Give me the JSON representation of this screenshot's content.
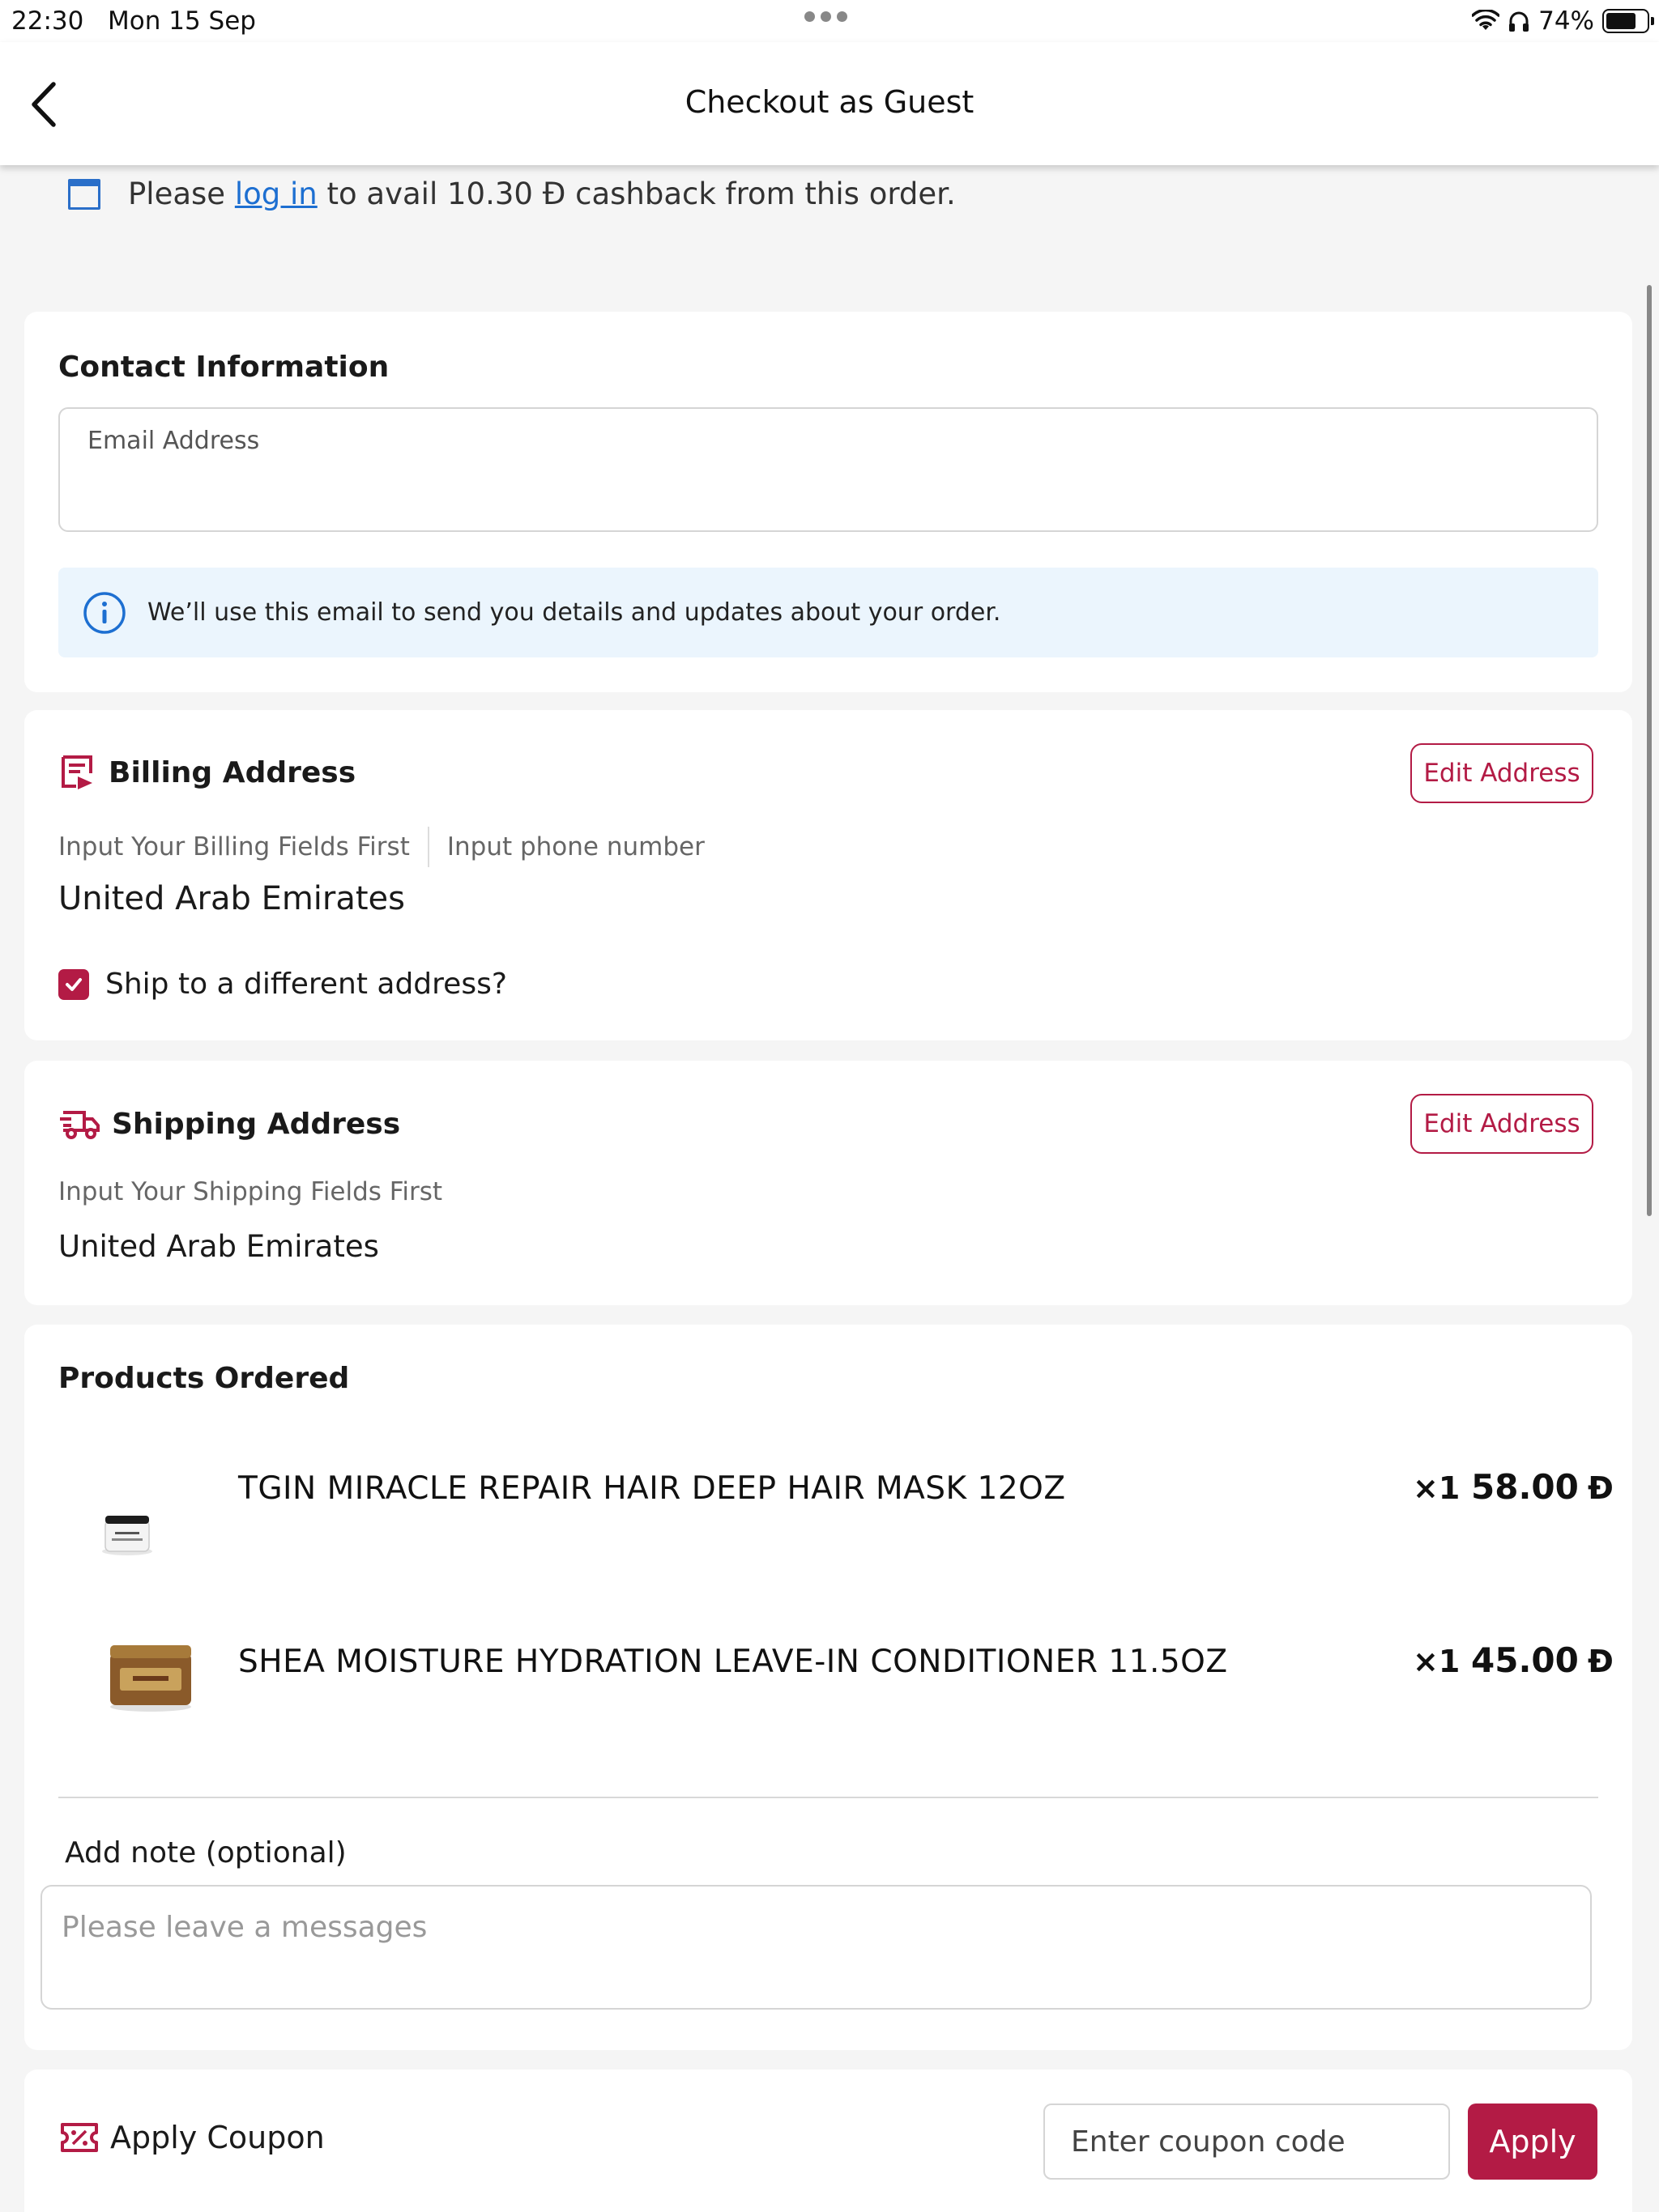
{
  "status": {
    "time": "22:30",
    "date": "Mon 15 Sep",
    "battery_text": "74%",
    "battery_level": 0.74
  },
  "nav": {
    "title": "Checkout as Guest"
  },
  "cashback": {
    "prefix": "Please",
    "link": "log in",
    "middle": "to avail 10.30",
    "currency": "Đ",
    "suffix": "cashback from this order."
  },
  "contact": {
    "title": "Contact Information",
    "email_placeholder": "Email Address",
    "info": "We’ll use this email to send you details and updates about your order."
  },
  "billing": {
    "title": "Billing Address",
    "edit_label": "Edit Address",
    "fields_hint": "Input Your Billing Fields First",
    "phone_hint": "Input phone number",
    "country": "United Arab Emirates",
    "ship_different_label": "Ship to a different address?",
    "ship_different_checked": true
  },
  "shipping": {
    "title": "Shipping Address",
    "edit_label": "Edit Address",
    "fields_hint": "Input Your Shipping Fields First",
    "country": "United Arab Emirates"
  },
  "products": {
    "title": "Products Ordered",
    "items": [
      {
        "name": "TGIN MIRACLE REPAIR HAIR DEEP HAIR MASK 12OZ",
        "qty": "×1",
        "price": "58.00",
        "currency": "Đ"
      },
      {
        "name": "SHEA MOISTURE HYDRATION LEAVE-IN CONDITIONER 11.5OZ",
        "qty": "×1",
        "price": "45.00",
        "currency": "Đ"
      }
    ],
    "note_label": "Add note (optional)",
    "note_placeholder": "Please leave a messages"
  },
  "coupon": {
    "label": "Apply Coupon",
    "input_placeholder": "Enter coupon code",
    "apply_label": "Apply"
  },
  "colors": {
    "accent": "#b31b45",
    "link": "#1d6fd1",
    "info_bg": "#ebf5fd"
  }
}
